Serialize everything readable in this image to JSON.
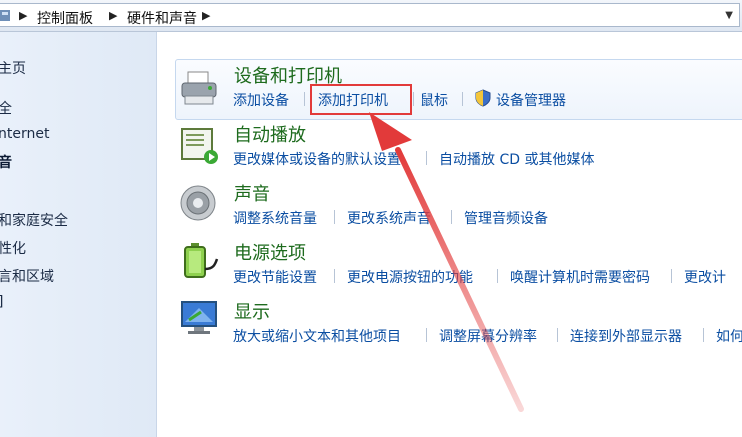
{
  "address_bar": {
    "crumbs": [
      "控制面板",
      "硬件和声音"
    ]
  },
  "left_nav": {
    "items": [
      {
        "label": "主页",
        "active": false
      },
      {
        "label": "全",
        "active": false
      },
      {
        "label": "nternet",
        "active": false
      },
      {
        "label": "音",
        "active": true
      },
      {
        "label": "和家庭安全",
        "active": false
      },
      {
        "label": "性化",
        "active": false
      },
      {
        "label": "言和区域",
        "active": false
      }
    ]
  },
  "categories": [
    {
      "title": "设备和打印机",
      "icon": "printer-icon",
      "links": [
        "添加设备",
        "添加打印机",
        "鼠标",
        "设备管理器"
      ]
    },
    {
      "title": "自动播放",
      "icon": "autoplay-icon",
      "links": [
        "更改媒体或设备的默认设置",
        "自动播放 CD 或其他媒体"
      ]
    },
    {
      "title": "声音",
      "icon": "speaker-icon",
      "links": [
        "调整系统音量",
        "更改系统声音",
        "管理音频设备"
      ]
    },
    {
      "title": "电源选项",
      "icon": "battery-icon",
      "links": [
        "更改节能设置",
        "更改电源按钮的功能",
        "唤醒计算机时需要密码",
        "更改计"
      ]
    },
    {
      "title": "显示",
      "icon": "monitor-icon",
      "links": [
        "放大或缩小文本和其他项目",
        "调整屏幕分辨率",
        "连接到外部显示器",
        "如何"
      ]
    }
  ],
  "annotation": {
    "highlight_color": "#e23a3a",
    "highlighted_link": "添加打印机"
  },
  "colors": {
    "link": "#0b4ea2",
    "title": "#1e6b1e"
  }
}
